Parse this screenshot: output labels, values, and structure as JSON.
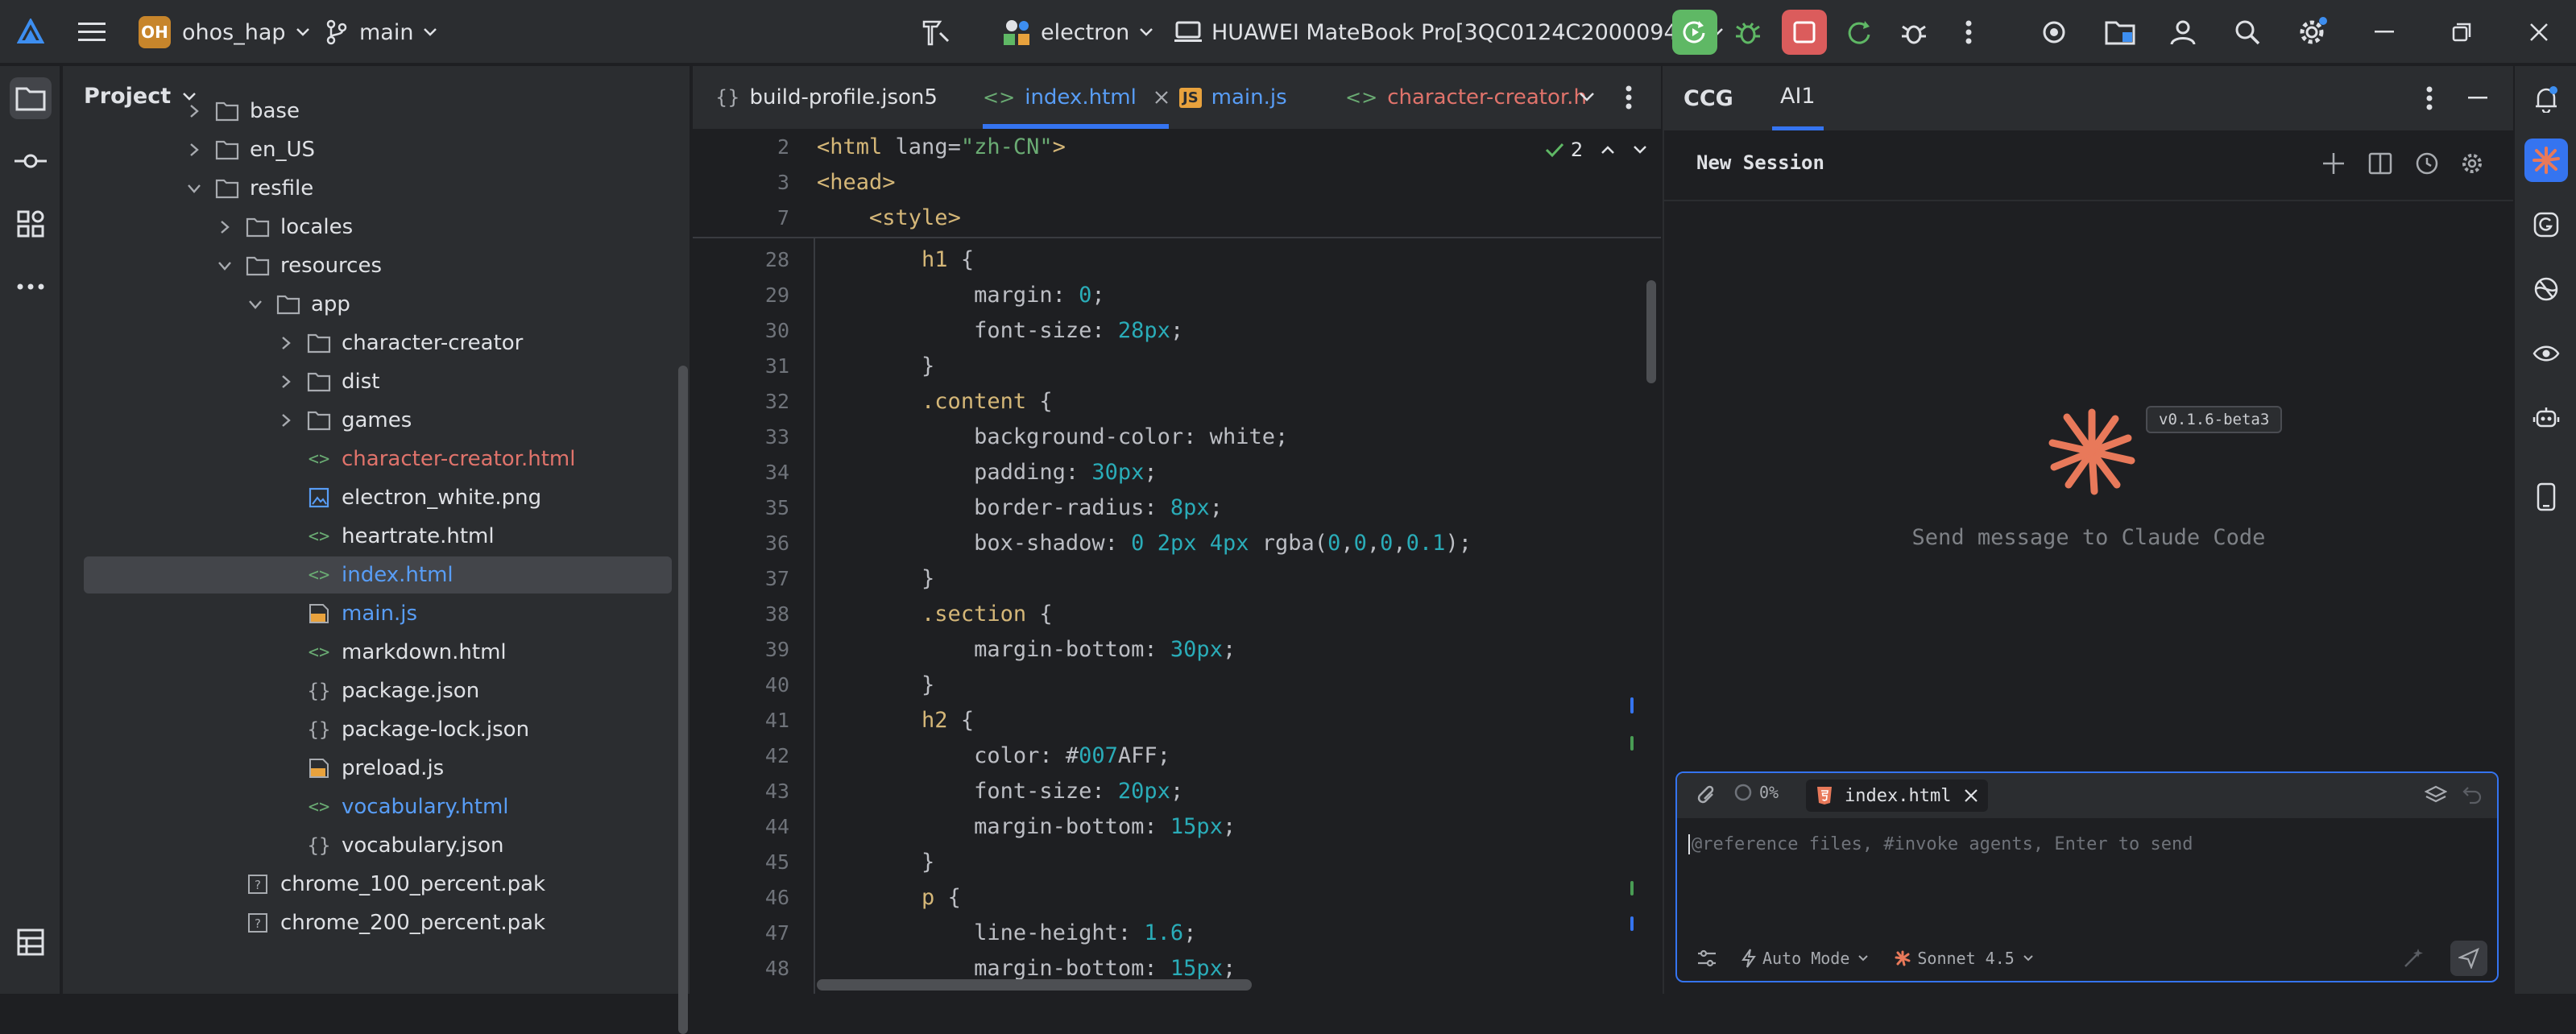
{
  "titlebar": {
    "project_badge": "OH",
    "project_name": "ohos_hap",
    "branch": "main",
    "run_config": "electron",
    "device": "HUAWEI MateBook Pro[3QC0124C20000944]",
    "icons": [
      "app-logo-icon",
      "hamburger-menu-icon",
      "branch-icon",
      "build-icon",
      "electron-config-icon",
      "device-icon",
      "run-icon",
      "debug-icon",
      "stop-icon",
      "rerun-icon",
      "profiler-icon",
      "more-icon",
      "target-icon",
      "folder-icon",
      "account-icon",
      "search-icon",
      "settings-icon",
      "minimize-icon",
      "restore-icon",
      "close-icon"
    ]
  },
  "project_panel": {
    "title": "Project",
    "tree": [
      {
        "label": "base",
        "kind": "folder",
        "indent": 0,
        "chevron": "right"
      },
      {
        "label": "en_US",
        "kind": "folder",
        "indent": 0,
        "chevron": "right"
      },
      {
        "label": "resfile",
        "kind": "folder",
        "indent": 0,
        "chevron": "down"
      },
      {
        "label": "locales",
        "kind": "folder",
        "indent": 1,
        "chevron": "right"
      },
      {
        "label": "resources",
        "kind": "folder",
        "indent": 1,
        "chevron": "down"
      },
      {
        "label": "app",
        "kind": "folder",
        "indent": 2,
        "chevron": "down"
      },
      {
        "label": "character-creator",
        "kind": "folder",
        "indent": 3,
        "chevron": "right"
      },
      {
        "label": "dist",
        "kind": "folder",
        "indent": 3,
        "chevron": "right"
      },
      {
        "label": "games",
        "kind": "folder",
        "indent": 3,
        "chevron": "right"
      },
      {
        "label": "character-creator.html",
        "kind": "html",
        "indent": 3,
        "color": "red"
      },
      {
        "label": "electron_white.png",
        "kind": "image",
        "indent": 3
      },
      {
        "label": "heartrate.html",
        "kind": "html",
        "indent": 3
      },
      {
        "label": "index.html",
        "kind": "html",
        "indent": 3,
        "color": "blue",
        "selected": true
      },
      {
        "label": "main.js",
        "kind": "js",
        "indent": 3,
        "color": "blue"
      },
      {
        "label": "markdown.html",
        "kind": "html",
        "indent": 3
      },
      {
        "label": "package.json",
        "kind": "json",
        "indent": 3
      },
      {
        "label": "package-lock.json",
        "kind": "json",
        "indent": 3
      },
      {
        "label": "preload.js",
        "kind": "js",
        "indent": 3
      },
      {
        "label": "vocabulary.html",
        "kind": "html",
        "indent": 3,
        "color": "blue"
      },
      {
        "label": "vocabulary.json",
        "kind": "json",
        "indent": 3
      },
      {
        "label": "chrome_100_percent.pak",
        "kind": "unknown",
        "indent": 1
      },
      {
        "label": "chrome_200_percent.pak",
        "kind": "unknown",
        "indent": 1
      }
    ]
  },
  "editor": {
    "tabs": [
      {
        "label": "build-profile.json5",
        "icon": "{}",
        "kind": "json"
      },
      {
        "label": "index.html",
        "icon": "<>",
        "kind": "html",
        "active": true,
        "closable": true
      },
      {
        "label": "main.js",
        "icon": "JS",
        "kind": "js"
      },
      {
        "label": "character-creator.h",
        "icon": "<>",
        "kind": "html",
        "color": "red"
      }
    ],
    "inspection_count": "2",
    "sticky_lines": [
      {
        "n": "2",
        "html": "<span class=\"tag\">&lt;html</span> <span class=\"attr\">lang=</span><span class=\"str\">\"zh-CN\"</span><span class=\"tag\">&gt;</span>"
      },
      {
        "n": "3",
        "html": "<span class=\"tag\">&lt;head&gt;</span>"
      },
      {
        "n": "7",
        "html": "    <span class=\"tag\">&lt;style&gt;</span>"
      }
    ],
    "lines": [
      {
        "n": "28",
        "text": "        h1 {"
      },
      {
        "n": "29",
        "text": "            margin: 0;"
      },
      {
        "n": "30",
        "text": "            font-size: 28px;"
      },
      {
        "n": "31",
        "text": "        }"
      },
      {
        "n": "32",
        "text": "        .content {"
      },
      {
        "n": "33",
        "text": "            background-color: white;"
      },
      {
        "n": "34",
        "text": "            padding: 30px;"
      },
      {
        "n": "35",
        "text": "            border-radius: 8px;"
      },
      {
        "n": "36",
        "text": "            box-shadow: 0 2px 4px rgba(0,0,0,0.1);"
      },
      {
        "n": "37",
        "text": "        }"
      },
      {
        "n": "38",
        "text": "        .section {"
      },
      {
        "n": "39",
        "text": "            margin-bottom: 30px;"
      },
      {
        "n": "40",
        "text": "        }"
      },
      {
        "n": "41",
        "text": "        h2 {"
      },
      {
        "n": "42",
        "text": "            color: #007AFF;"
      },
      {
        "n": "43",
        "text": "            font-size: 20px;"
      },
      {
        "n": "44",
        "text": "            margin-bottom: 15px;"
      },
      {
        "n": "45",
        "text": "        }"
      },
      {
        "n": "46",
        "text": "        p {"
      },
      {
        "n": "47",
        "text": "            line-height: 1.6;"
      },
      {
        "n": "48",
        "text": "            margin-bottom: 15px;"
      }
    ]
  },
  "ai_panel": {
    "tabs": [
      {
        "label": "CCG",
        "active": false
      },
      {
        "label": "AI1",
        "active": true
      }
    ],
    "session_title": "New Session",
    "version": "v0.1.6-beta3",
    "empty_message": "Send message to Claude Code",
    "context_percent": "0%",
    "attached_file": "index.html",
    "input_placeholder": "@reference files, #invoke agents, Enter to send",
    "mode": "Auto Mode",
    "model": "Sonnet 4.5"
  },
  "colors": {
    "accent": "#3574f0",
    "run_green": "#5fb865",
    "stop_red": "#db5c5c",
    "claude_orange": "#e8795a",
    "folder_blue": "#589df6"
  }
}
